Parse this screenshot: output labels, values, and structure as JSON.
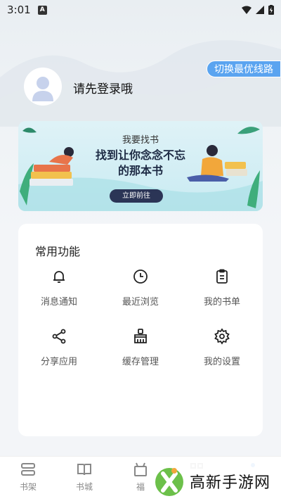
{
  "status_bar": {
    "time": "3:01",
    "notif_letter": "A"
  },
  "header": {
    "route_switch_label": "切换最优线路",
    "login_prompt": "请先登录哦"
  },
  "banner": {
    "title": "我要找书",
    "headline_line1": "找到让你念念不忘",
    "headline_line2": "的那本书",
    "button_label": "立即前往"
  },
  "functions": {
    "title": "常用功能",
    "items": [
      {
        "label": "消息通知",
        "icon": "bell-icon"
      },
      {
        "label": "最近浏览",
        "icon": "clock-icon"
      },
      {
        "label": "我的书单",
        "icon": "clipboard-icon"
      },
      {
        "label": "分享应用",
        "icon": "share-icon"
      },
      {
        "label": "缓存管理",
        "icon": "broom-icon"
      },
      {
        "label": "我的设置",
        "icon": "gear-icon"
      }
    ]
  },
  "bottom_nav": {
    "items": [
      {
        "label": "书架",
        "icon": "bookshelf-icon"
      },
      {
        "label": "书城",
        "icon": "book-icon"
      },
      {
        "label": "福",
        "icon": "gift-icon"
      },
      {
        "label": "",
        "icon": "grid-icon"
      },
      {
        "label": "",
        "icon": "profile-icon",
        "active": true
      }
    ]
  },
  "watermark": {
    "text": "高新手游网"
  },
  "colors": {
    "accent": "#5aa4f0",
    "banner_button": "#2b3556",
    "active_dot": "#3b8ef0"
  }
}
